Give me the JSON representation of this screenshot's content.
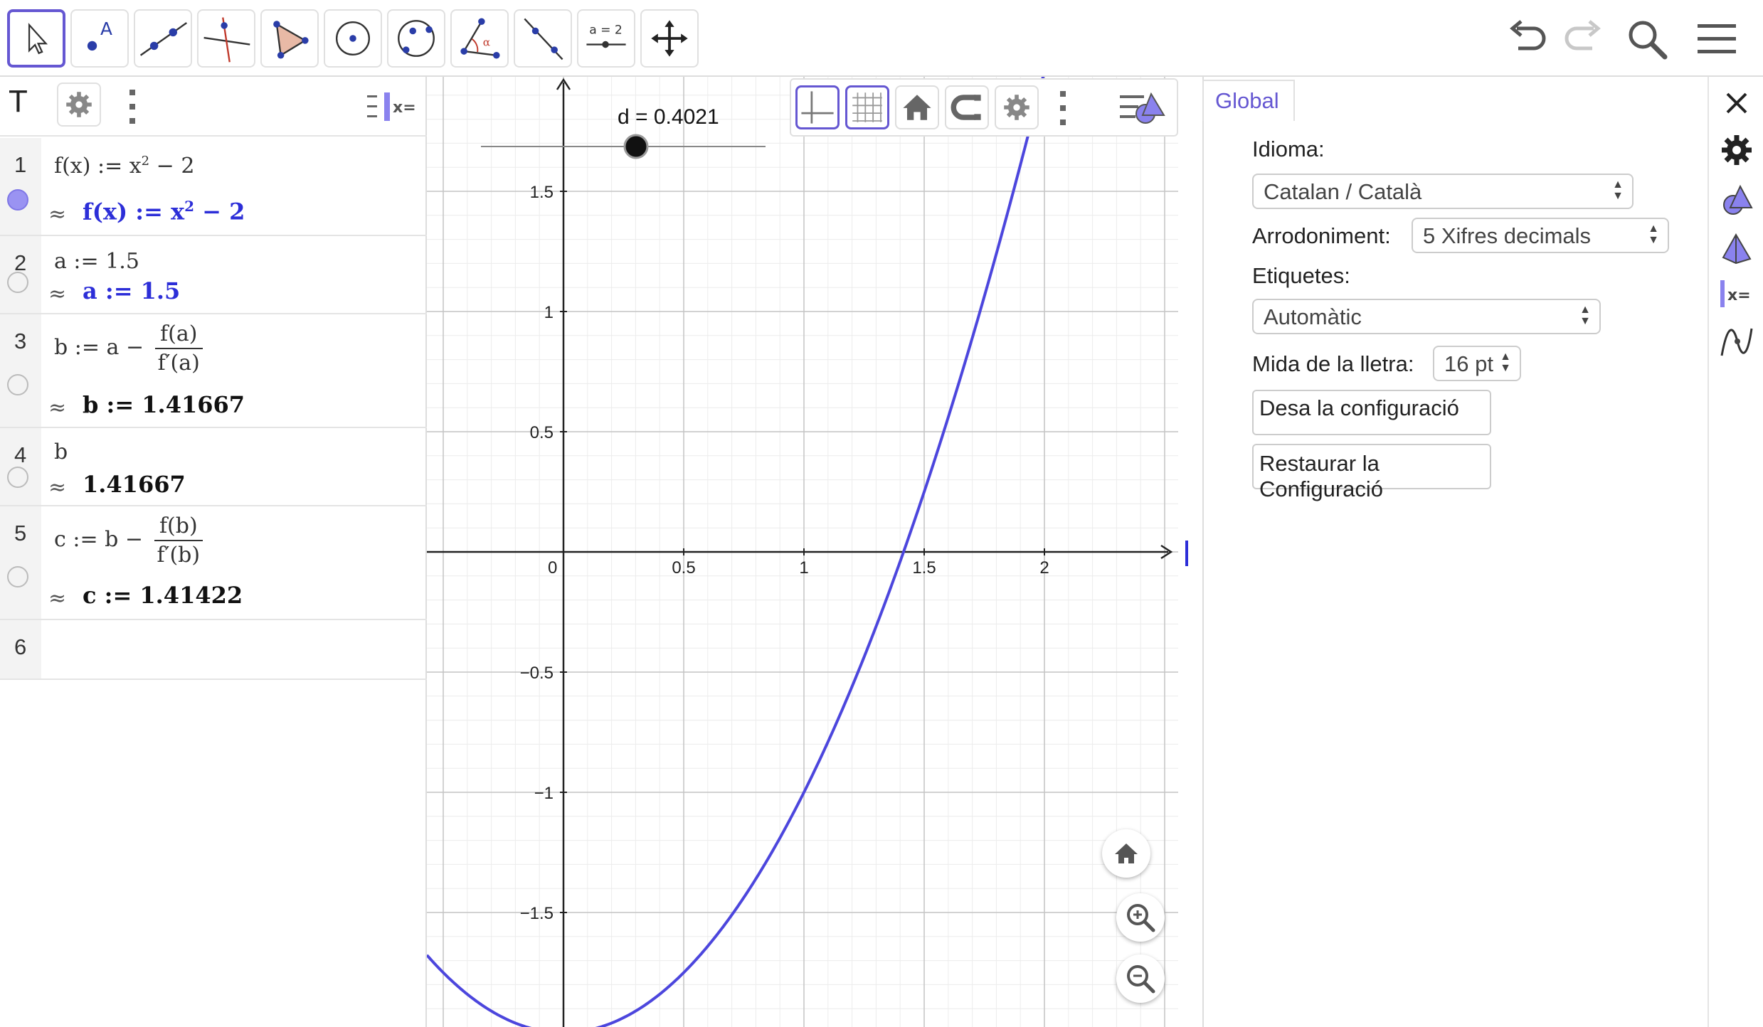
{
  "toolbar": {
    "tools": [
      {
        "name": "move-tool",
        "icon": "cursor-arrow-icon",
        "selected": true
      },
      {
        "name": "point-tool",
        "icon": "point-icon",
        "glyph": "A"
      },
      {
        "name": "line-tool",
        "icon": "line-through-points-icon"
      },
      {
        "name": "perpendicular-line-tool",
        "icon": "perpendicular-line-icon"
      },
      {
        "name": "polygon-tool",
        "icon": "polygon-icon"
      },
      {
        "name": "circle-center-point-tool",
        "icon": "circle-center-icon"
      },
      {
        "name": "circle-three-points-tool",
        "icon": "circle-three-points-icon"
      },
      {
        "name": "angle-tool",
        "icon": "angle-icon",
        "glyph": "α"
      },
      {
        "name": "reflect-tool",
        "icon": "reflect-line-icon"
      },
      {
        "name": "slider-tool",
        "icon": "slider-icon",
        "glyph": "a = 2"
      },
      {
        "name": "move-graphics-view-tool",
        "icon": "move-arrows-icon"
      }
    ],
    "right_icons": [
      "undo-icon",
      "redo-icon",
      "search-icon",
      "menu-icon"
    ]
  },
  "algebra": {
    "header_icons": [
      "text-style-icon",
      "gear-icon",
      "more-vertical-icon",
      "algebra-description-icon"
    ],
    "header_t": "T",
    "approx": "≈",
    "rows": [
      {
        "num": "1",
        "input": "f(x) := x² − 2",
        "output": "f(x) := x² − 2",
        "visible": true
      },
      {
        "num": "2",
        "input": "a := 1.5",
        "output": "a := 1.5",
        "visible": false
      },
      {
        "num": "3",
        "input_lhs": "b := a −",
        "input_num": "f(a)",
        "input_den": "f′(a)",
        "output": "b := 1.41667",
        "visible": false
      },
      {
        "num": "4",
        "input": "b",
        "output": "1.41667",
        "visible": false
      },
      {
        "num": "5",
        "input_lhs": "c := b −",
        "input_num": "f(b)",
        "input_den": "f′(b)",
        "output": "c := 1.41422",
        "visible": false
      },
      {
        "num": "6"
      }
    ]
  },
  "graphics": {
    "slider_label": "d = 0.4021",
    "slider_value": 0.4021,
    "x_ticks": [
      "0",
      "0.5",
      "1",
      "1.5",
      "2"
    ],
    "y_ticks": [
      "1.5",
      "1",
      "0.5",
      "−0.5",
      "−1",
      "−1.5"
    ],
    "function": "x^2 - 2",
    "curve_color": "#4c46dd",
    "style_bar_icons": [
      "axes-icon",
      "grid-icon",
      "home-icon",
      "point-capturing-icon",
      "gear-icon",
      "more-vertical-icon",
      "graphics-style-icon"
    ],
    "zoom_icons": [
      "home-icon",
      "zoom-in-icon",
      "zoom-out-icon"
    ]
  },
  "settings": {
    "tab_label": "Global",
    "language_label": "Idioma:",
    "language_value": "Catalan / Català",
    "rounding_label": "Arrodoniment:",
    "rounding_value": "5 Xifres decimals",
    "labels_label": "Etiquetes:",
    "labels_value": "Automàtic",
    "font_size_label": "Mida de la lletra:",
    "font_size_value": "16 pt",
    "save_button": "Desa la configuració",
    "restore_button_line1": "Restaurar la",
    "restore_button_line2": "Configuració",
    "side_icons": [
      "close-icon",
      "gear-icon",
      "graphics-settings-icon",
      "3d-settings-icon",
      "algebra-settings-icon",
      "function-settings-icon"
    ]
  },
  "colors": {
    "accent": "#6557d2",
    "curve": "#4c46dd",
    "algebra_blue": "#2c2ed8"
  }
}
